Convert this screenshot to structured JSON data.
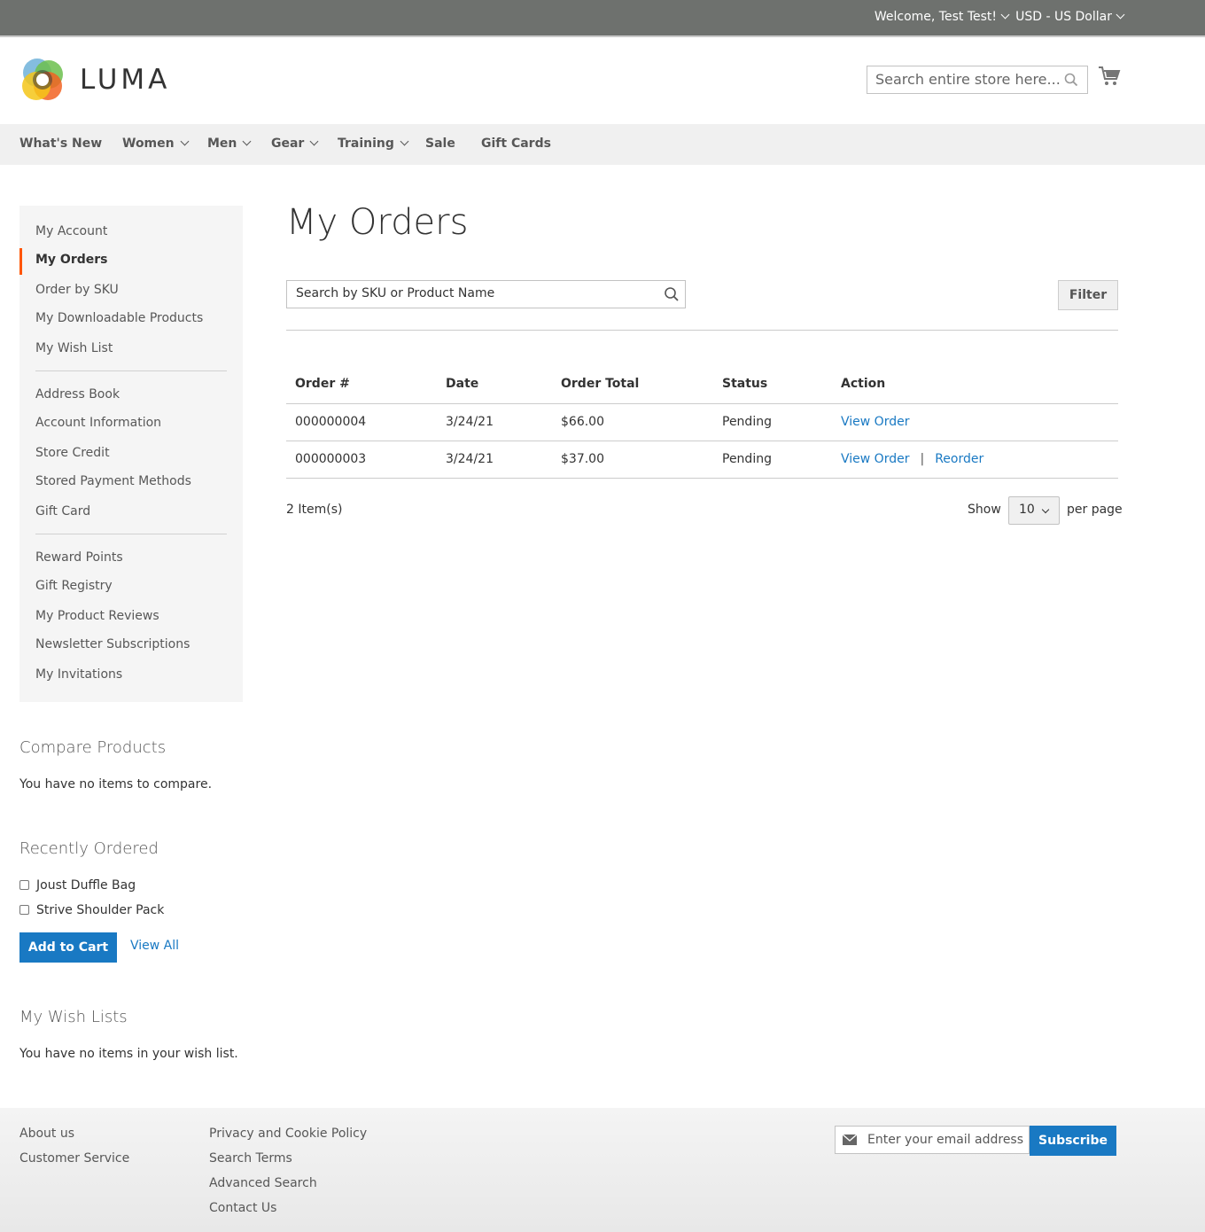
{
  "topbar": {
    "welcome": "Welcome, Test Test!",
    "currency": "USD - US Dollar"
  },
  "header": {
    "logo_text": "LUMA",
    "search_placeholder": "Search entire store here..."
  },
  "nav": [
    {
      "label": "What's New"
    },
    {
      "label": "Women"
    },
    {
      "label": "Men"
    },
    {
      "label": "Gear"
    },
    {
      "label": "Training"
    },
    {
      "label": "Sale"
    },
    {
      "label": "Gift Cards"
    }
  ],
  "sidebar": {
    "items": [
      "My Account",
      "My Orders",
      "Order by SKU",
      "My Downloadable Products",
      "My Wish List",
      "Address Book",
      "Account Information",
      "Store Credit",
      "Stored Payment Methods",
      "Gift Card",
      "Reward Points",
      "Gift Registry",
      "My Product Reviews",
      "Newsletter Subscriptions",
      "My Invitations"
    ],
    "active": "My Orders"
  },
  "compare": {
    "title": "Compare Products",
    "empty": "You have no items to compare."
  },
  "recently_ordered": {
    "title": "Recently Ordered",
    "items": [
      "Joust Duffle Bag",
      "Strive Shoulder Pack"
    ],
    "add_to_cart": "Add to Cart",
    "view_all": "View All"
  },
  "wishlists": {
    "title": "My Wish Lists",
    "empty": "You have no items in your wish list."
  },
  "main": {
    "title": "My Orders",
    "search_placeholder": "Search by SKU or Product Name",
    "filter_label": "Filter",
    "columns": [
      "Order #",
      "Date",
      "Order Total",
      "Status",
      "Action"
    ],
    "rows": [
      {
        "order": "000000004",
        "date": "3/24/21",
        "total": "$66.00",
        "status": "Pending",
        "view": "View Order"
      },
      {
        "order": "000000003",
        "date": "3/24/21",
        "total": "$37.00",
        "status": "Pending",
        "view": "View Order",
        "reorder": "Reorder"
      }
    ],
    "separator": "|",
    "items_count": "2 Item(s)",
    "show_label": "Show",
    "per_page_value": "10",
    "per_page_label": "per page"
  },
  "footer": {
    "col1": [
      "About us",
      "Customer Service"
    ],
    "col2": [
      "Privacy and Cookie Policy",
      "Search Terms",
      "Advanced Search",
      "Contact Us"
    ],
    "newsletter_placeholder": "Enter your email address",
    "subscribe_label": "Subscribe"
  }
}
